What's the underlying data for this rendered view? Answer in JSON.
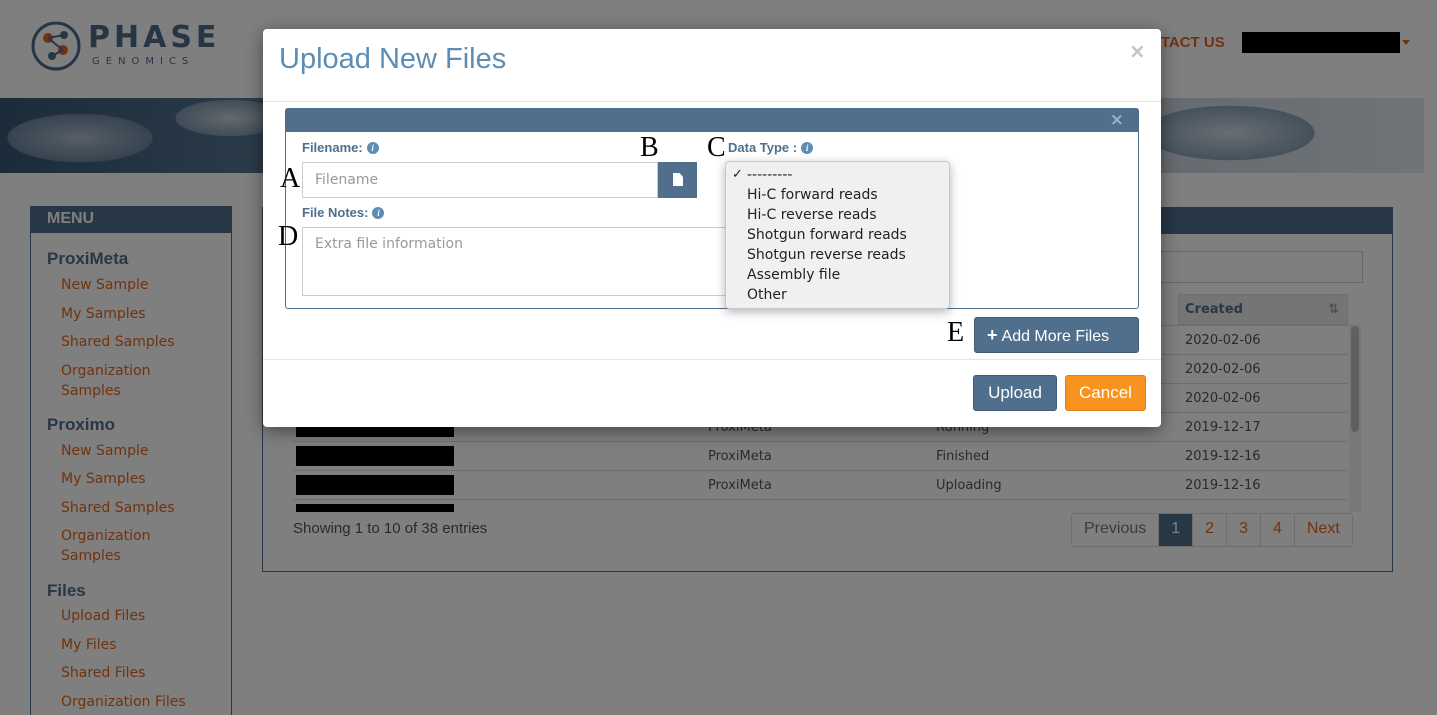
{
  "header": {
    "logo_word": "PHASE",
    "logo_sub": "GENOMICS",
    "contact_label": "NTACT US"
  },
  "sidebar": {
    "title": "MENU",
    "sections": [
      {
        "title": "ProxiMeta",
        "items": [
          "New Sample",
          "My Samples",
          "Shared Samples",
          "Organization Samples"
        ]
      },
      {
        "title": "Proximo",
        "items": [
          "New Sample",
          "My Samples",
          "Shared Samples",
          "Organization Samples"
        ]
      },
      {
        "title": "Files",
        "items": [
          "Upload Files",
          "My Files",
          "Shared Files",
          "Organization Files"
        ]
      }
    ]
  },
  "table": {
    "created_header": "Created",
    "rows": [
      {
        "type": "",
        "status": "",
        "created": "2020-02-06"
      },
      {
        "type": "",
        "status": "",
        "created": "2020-02-06"
      },
      {
        "type": "",
        "status": "",
        "created": "2020-02-06"
      },
      {
        "type": "ProxiMeta",
        "status": "Running",
        "created": "2019-12-17"
      },
      {
        "type": "ProxiMeta",
        "status": "Finished",
        "created": "2019-12-16"
      },
      {
        "type": "ProxiMeta",
        "status": "Uploading",
        "created": "2019-12-16"
      }
    ],
    "showing": "Showing 1 to 10 of 38 entries",
    "pagination": {
      "prev": "Previous",
      "pages": [
        "1",
        "2",
        "3",
        "4"
      ],
      "next": "Next",
      "active": "1"
    }
  },
  "modal": {
    "title": "Upload New Files",
    "close_glyph": "×",
    "card_close_glyph": "×",
    "filename_label": "Filename:",
    "filename_placeholder": "Filename",
    "datatype_label": "Data Type :",
    "notes_label": "File Notes:",
    "notes_placeholder": "Extra file information",
    "info_glyph": "i",
    "datatype_options": [
      "---------",
      "Hi-C forward reads",
      "Hi-C reverse reads",
      "Shotgun forward reads",
      "Shotgun reverse reads",
      "Assembly file",
      "Other"
    ],
    "datatype_selected": "---------",
    "check_glyph": "✓",
    "add_more_label": "Add More Files",
    "plus_glyph": "+",
    "upload_label": "Upload",
    "cancel_label": "Cancel"
  },
  "annotations": {
    "a": "A",
    "b": "B",
    "c": "C",
    "d": "D",
    "e": "E"
  },
  "colors": {
    "brand": "#4f6f8d",
    "accent": "#e2661c",
    "title": "#5d8db4",
    "cancel": "#f7931e"
  }
}
